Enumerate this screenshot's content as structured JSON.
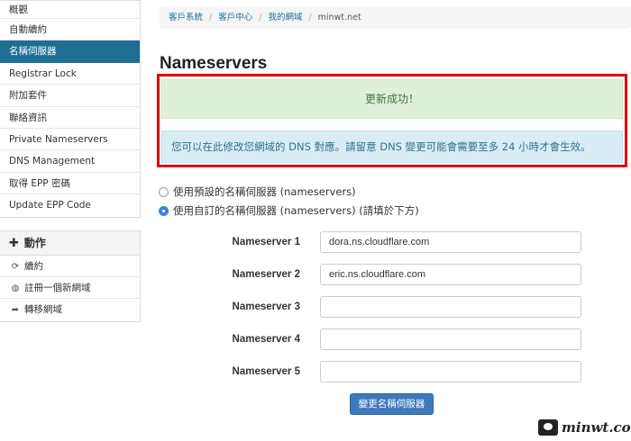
{
  "sidebar": {
    "items": [
      {
        "label": "概觀",
        "active": false
      },
      {
        "label": "自動續約",
        "active": false
      },
      {
        "label": "名稱伺服器",
        "active": true
      },
      {
        "label": "Registrar Lock",
        "active": false
      },
      {
        "label": "附加套件",
        "active": false
      },
      {
        "label": "聯絡資訊",
        "active": false
      },
      {
        "label": "Private Nameservers",
        "active": false
      },
      {
        "label": "DNS Management",
        "active": false
      },
      {
        "label": "取得 EPP 密碼",
        "active": false
      },
      {
        "label": "Update EPP Code",
        "active": false
      }
    ],
    "actions": {
      "header": "動作",
      "header_icon": "plus-icon",
      "items": [
        {
          "label": "續約",
          "icon": "refresh-icon"
        },
        {
          "label": "註冊一個新網域",
          "icon": "globe-icon"
        },
        {
          "label": "轉移網域",
          "icon": "share-icon"
        }
      ]
    }
  },
  "breadcrumb": {
    "items": [
      "客戶系統",
      "客戶中心",
      "我的網域"
    ],
    "current": "minwt.net"
  },
  "page": {
    "title": "Nameservers"
  },
  "alerts": {
    "success": "更新成功！",
    "info": "您可以在此修改您網域的 DNS 對應。請留意 DNS 變更可能會需要至多 24 小時才會生效。"
  },
  "options": {
    "default_ns": {
      "label": "使用預設的名稱伺服器 (nameservers)",
      "checked": false
    },
    "custom_ns": {
      "label": "使用自訂的名稱伺服器 (nameservers) (請填於下方)",
      "checked": true
    }
  },
  "nameservers": [
    {
      "label": "Nameserver 1",
      "value": "dora.ns.cloudflare.com"
    },
    {
      "label": "Nameserver 2",
      "value": "eric.ns.cloudflare.com"
    },
    {
      "label": "Nameserver 3",
      "value": ""
    },
    {
      "label": "Nameserver 4",
      "value": ""
    },
    {
      "label": "Nameserver 5",
      "value": ""
    }
  ],
  "submit_label": "變更名稱伺服器",
  "watermark": "minwt.com",
  "colors": {
    "active_nav": "#1e6e94",
    "highlight_border": "#e00000",
    "success_bg": "#dff0d8",
    "info_bg": "#d9edf7",
    "button": "#3f78bd"
  }
}
